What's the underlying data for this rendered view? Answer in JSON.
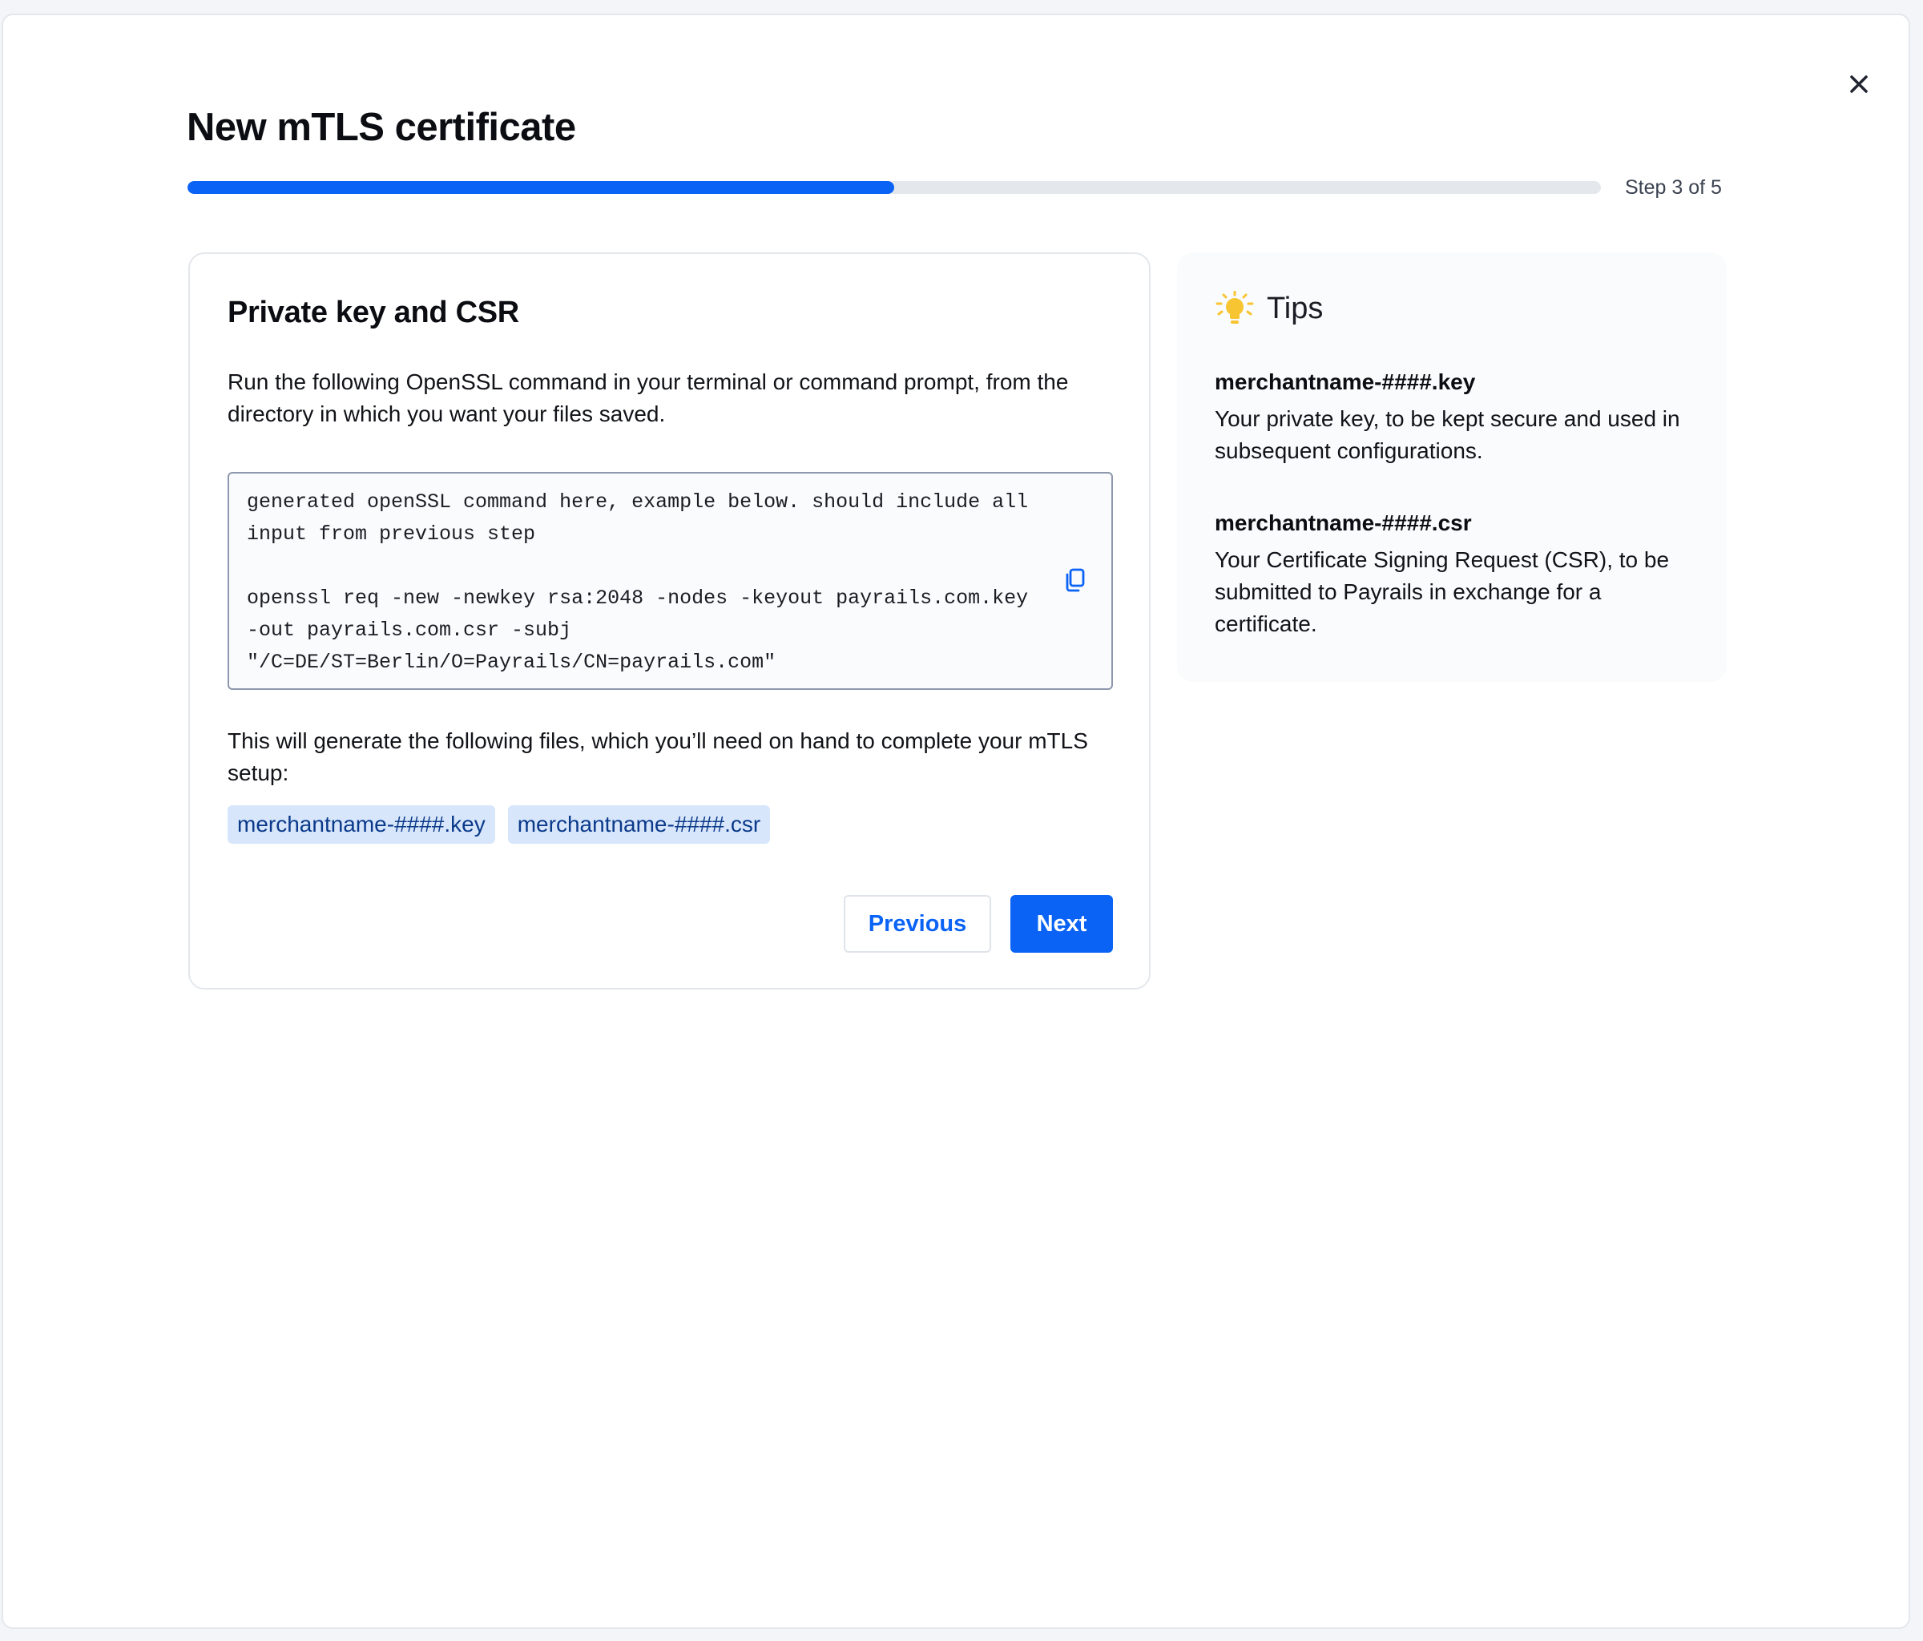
{
  "modal": {
    "title": "New mTLS certificate",
    "step_label": "Step 3 of 5",
    "progress_fraction": 0.5,
    "close_icon": "close-icon"
  },
  "card": {
    "title": "Private key and CSR",
    "intro": "Run the following OpenSSL command in your terminal or command prompt, from the directory in which you want your files saved.",
    "code": "generated openSSL command here, example below. should include all input from previous step\n\nopenssl req -new -newkey rsa:2048 -nodes -keyout payrails.com.key -out payrails.com.csr -subj \"/C=DE/ST=Berlin/O=Payrails/CN=payrails.com\"",
    "copy_icon": "copy-icon",
    "files_text": "This will generate the following files, which you’ll need on hand to complete your mTLS setup:",
    "files": [
      "merchantname-####.key",
      "merchantname-####.csr"
    ],
    "previous_label": "Previous",
    "next_label": "Next"
  },
  "tips": {
    "icon": "lightbulb-icon",
    "title": "Tips",
    "items": [
      {
        "name": "merchantname-####.key",
        "description": "Your private key, to be kept secure and used in subsequent configurations."
      },
      {
        "name": "merchantname-####.csr",
        "description": "Your Certificate Signing Request (CSR), to be submitted to Payrails in exchange for a certificate."
      }
    ]
  },
  "colors": {
    "accent": "#0b63f5",
    "chip_bg": "#d7e6fb",
    "chip_text": "#0b3a8a",
    "tip_icon": "#f7c531"
  }
}
